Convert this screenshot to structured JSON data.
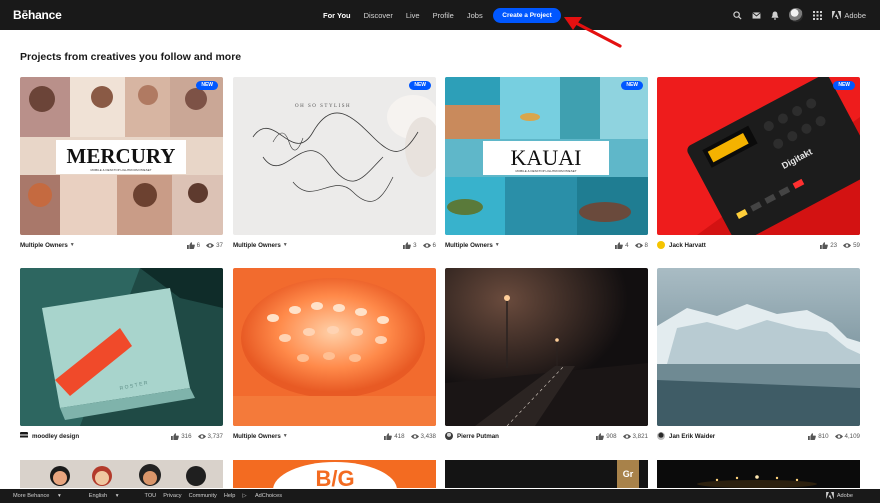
{
  "header": {
    "logo": "Bēhance",
    "nav": [
      "For You",
      "Discover",
      "Live",
      "Profile",
      "Jobs"
    ],
    "create_button": "Create a Project",
    "adobe_label": "Adobe"
  },
  "section_title": "Projects from creatives you follow and more",
  "badge_new": "NEW",
  "cards": [
    {
      "owner": "Multiple Owners",
      "dropdown": true,
      "likes": "6",
      "views": "37",
      "new": true,
      "image_text": "MERCURY",
      "image_subtext": "MOBILE & DESKTOP LIGHTROOM PRESET"
    },
    {
      "owner": "Multiple Owners",
      "dropdown": true,
      "likes": "3",
      "views": "6",
      "new": true,
      "image_text": "OH SO STYLISH"
    },
    {
      "owner": "Multiple Owners",
      "dropdown": true,
      "likes": "4",
      "views": "8",
      "new": true,
      "image_text": "KAUAI",
      "image_subtext": "MOBILE & DESKTOP LIGHTROOM PRESET"
    },
    {
      "owner": "Jack Harvatt",
      "dropdown": false,
      "likes": "23",
      "views": "59",
      "new": true,
      "image_text": "Digitakt"
    },
    {
      "owner": "moodley design",
      "dropdown": false,
      "likes": "316",
      "views": "3,737",
      "new": false,
      "image_text": "ROSTER"
    },
    {
      "owner": "Multiple Owners",
      "dropdown": true,
      "likes": "418",
      "views": "3,438",
      "new": false
    },
    {
      "owner": "Pierre Putman",
      "dropdown": false,
      "likes": "908",
      "views": "3,821",
      "new": false
    },
    {
      "owner": "Jan Erik Waider",
      "dropdown": false,
      "likes": "810",
      "views": "4,109",
      "new": false
    }
  ],
  "partial_row": {
    "gr_badge": "Gr"
  },
  "footer": {
    "more": "More Behance",
    "language": "English",
    "links": [
      "TOU",
      "Privacy",
      "Community",
      "Help"
    ],
    "adchoices": "AdChoices",
    "adobe": "Adobe"
  },
  "colors": {
    "topbar": "#191919",
    "brand_blue": "#0057ff",
    "annotation_red": "#e41010"
  }
}
